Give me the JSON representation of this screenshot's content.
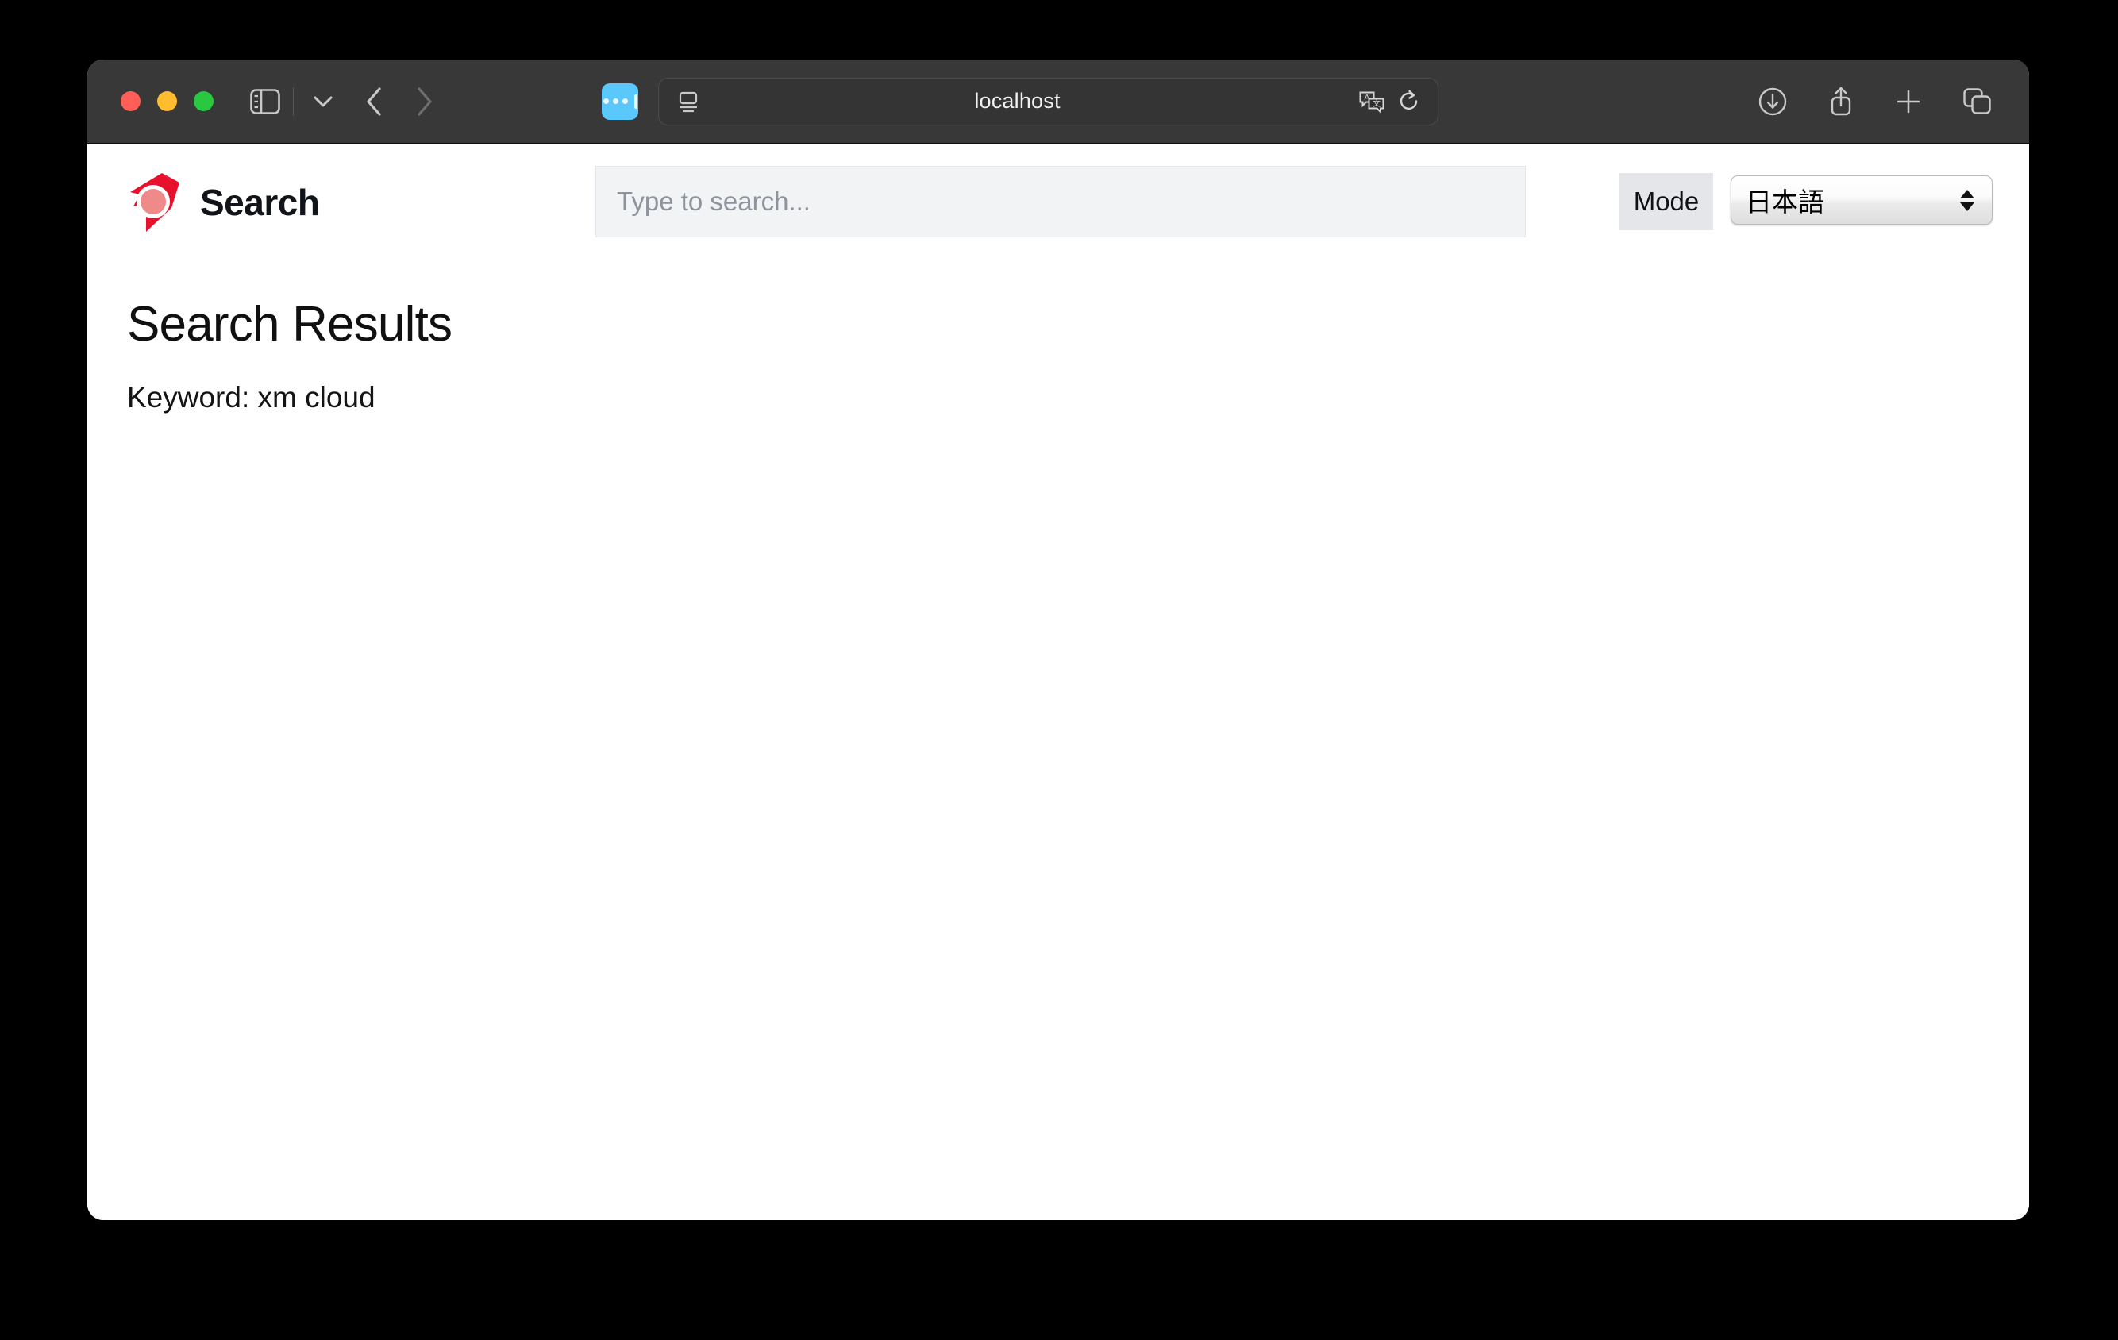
{
  "browser": {
    "window_controls": [
      {
        "name": "close",
        "color": "#ff5f57"
      },
      {
        "name": "minimize",
        "color": "#febc2e"
      },
      {
        "name": "zoom",
        "color": "#28c840"
      }
    ],
    "toolbar_left_icons": [
      "sidebar-icon",
      "chevron-down-icon",
      "back-icon",
      "forward-icon"
    ],
    "extension_icon": "extension-blue-icon",
    "address_bar": {
      "reader_icon": "reader-view-icon",
      "url": "localhost",
      "translate_icon": "translate-icon",
      "reload_icon": "reload-icon"
    },
    "toolbar_right_icons": [
      "downloads-icon",
      "share-icon",
      "new-tab-icon",
      "tab-overview-icon"
    ]
  },
  "site": {
    "brand_name": "Search",
    "brand_logo": "sitecore-search-logo",
    "accent_color": "#e8112d",
    "logo_inner_color": "#ef8a8a"
  },
  "search": {
    "value": "",
    "placeholder": "Type to search..."
  },
  "controls": {
    "mode_label": "Mode",
    "language_selected": "日本語",
    "language_options": [
      "日本語"
    ]
  },
  "main": {
    "title": "Search Results",
    "keyword_line": "Keyword: xm cloud"
  }
}
